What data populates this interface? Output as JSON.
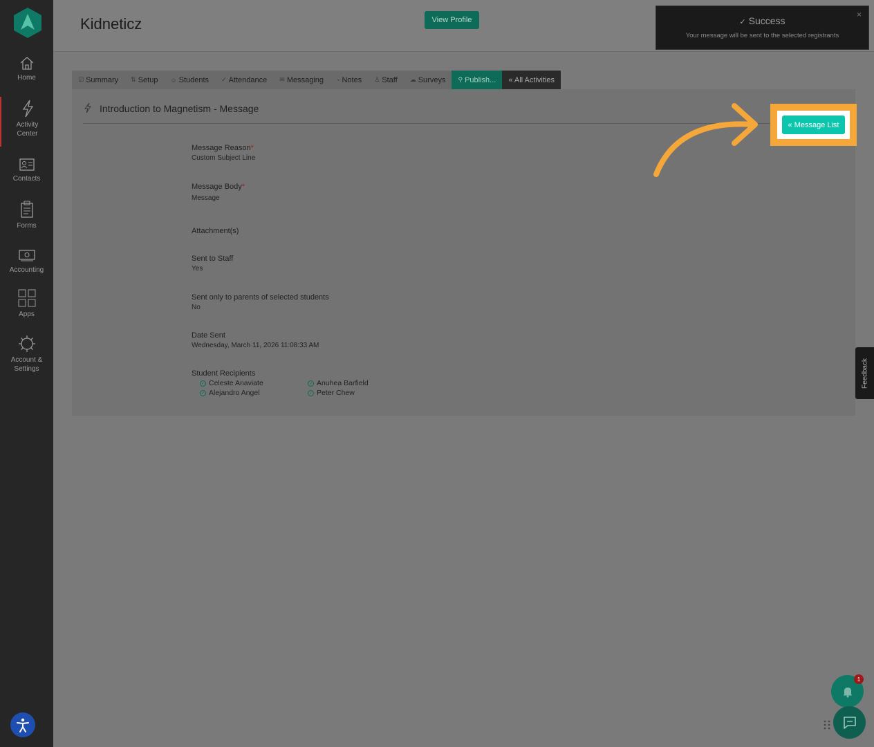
{
  "sidebar": {
    "items": [
      {
        "label": "Home",
        "icon": "home-icon"
      },
      {
        "label": "Activity\nCenter",
        "icon": "bolt-icon"
      },
      {
        "label": "Contacts",
        "icon": "contact-card-icon"
      },
      {
        "label": "Forms",
        "icon": "clipboard-icon"
      },
      {
        "label": "Accounting",
        "icon": "money-icon"
      },
      {
        "label": "Apps",
        "icon": "grid-icon"
      },
      {
        "label": "Account &\nSettings",
        "icon": "gear-icon"
      }
    ]
  },
  "header": {
    "title": "Kidneticz",
    "view_profile": "View Profile"
  },
  "toast": {
    "title": "Success",
    "message": "Your message will be sent to the selected registrants",
    "close": "×"
  },
  "tabs": [
    {
      "label": "Summary",
      "icon": "☑"
    },
    {
      "label": "Setup",
      "icon": "⇅"
    },
    {
      "label": "Students",
      "icon": "☺"
    },
    {
      "label": "Attendance",
      "icon": "✓"
    },
    {
      "label": "Messaging",
      "icon": "✉"
    },
    {
      "label": "Notes",
      "icon": "◔"
    },
    {
      "label": "Staff",
      "icon": "♙"
    },
    {
      "label": "Surveys",
      "icon": "☁"
    },
    {
      "label": "Publish...",
      "icon": "⚲"
    },
    {
      "label": "« All Activities",
      "icon": ""
    }
  ],
  "panel": {
    "title": "Introduction to Magnetism - Message",
    "message_list_button": "« Message List"
  },
  "fields": {
    "reason_label": "Message Reason",
    "reason_value": "Custom Subject Line",
    "body_label": "Message Body",
    "body_value": "Message",
    "attachments_label": "Attachment(s)",
    "staff_label": "Sent to Staff",
    "staff_value": "Yes",
    "parents_label": "Sent only to parents of selected students",
    "parents_value": "No",
    "date_label": "Date Sent",
    "date_value": "Wednesday, March 11, 2026 11:08:33 AM",
    "recipients_label": "Student Recipients",
    "required_mark": "*"
  },
  "recipients": [
    "Celeste Anaviate",
    "Alejandro Angel",
    "Anuhea Barfield",
    "Peter Chew"
  ],
  "feedback": "Feedback",
  "notifications_count": "1",
  "colors": {
    "brand_green": "#0d6b58",
    "accent_teal": "#0bc6ad",
    "highlight_orange": "#f5a73a"
  }
}
